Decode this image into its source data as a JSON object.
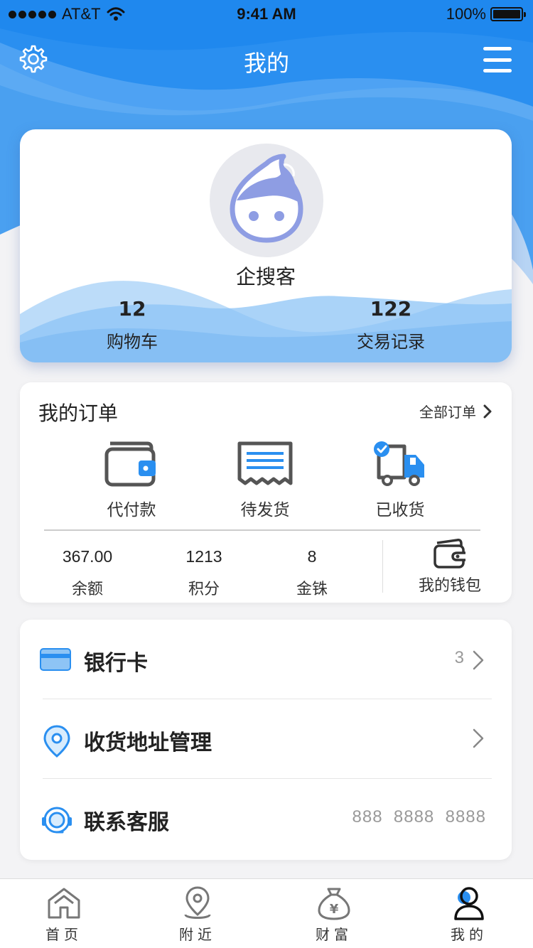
{
  "status_bar": {
    "carrier": "AT&T",
    "time": "9:41 AM",
    "battery": "100%"
  },
  "nav": {
    "title": "我的",
    "settings_icon": "gear-icon",
    "menu_icon": "hamburger-icon"
  },
  "profile": {
    "username": "企搜客",
    "cart": {
      "count": "12",
      "label": "购物车"
    },
    "transactions": {
      "count": "122",
      "label": "交易记录"
    }
  },
  "orders": {
    "title": "我的订单",
    "all_label": "全部订单",
    "items": [
      {
        "label": "代付款",
        "icon": "wallet-icon"
      },
      {
        "label": "待发货",
        "icon": "receipt-icon"
      },
      {
        "label": "已收货",
        "icon": "truck-icon"
      }
    ],
    "balances": [
      {
        "value": "367.00",
        "label": "余额"
      },
      {
        "value": "1213",
        "label": "积分"
      },
      {
        "value": "8",
        "label": "金铢"
      }
    ],
    "wallet_label": "我的钱包"
  },
  "menu_list": [
    {
      "label": "银行卡",
      "value": "3",
      "icon": "bank-card-icon"
    },
    {
      "label": "收货地址管理",
      "value": "",
      "icon": "location-pin-icon"
    },
    {
      "label": "联系客服",
      "value": "888  8888  8888",
      "icon": "headset-icon"
    }
  ],
  "tabbar": {
    "tabs": [
      {
        "label": "首页",
        "icon": "home-icon"
      },
      {
        "label": "附近",
        "icon": "location-icon"
      },
      {
        "label": "财富",
        "icon": "money-bag-icon"
      },
      {
        "label": "我的",
        "icon": "person-icon"
      }
    ]
  },
  "colors": {
    "primary": "#2a8ff0",
    "light_blue": "#8ec4f5",
    "avatar": "#8e9de3"
  }
}
